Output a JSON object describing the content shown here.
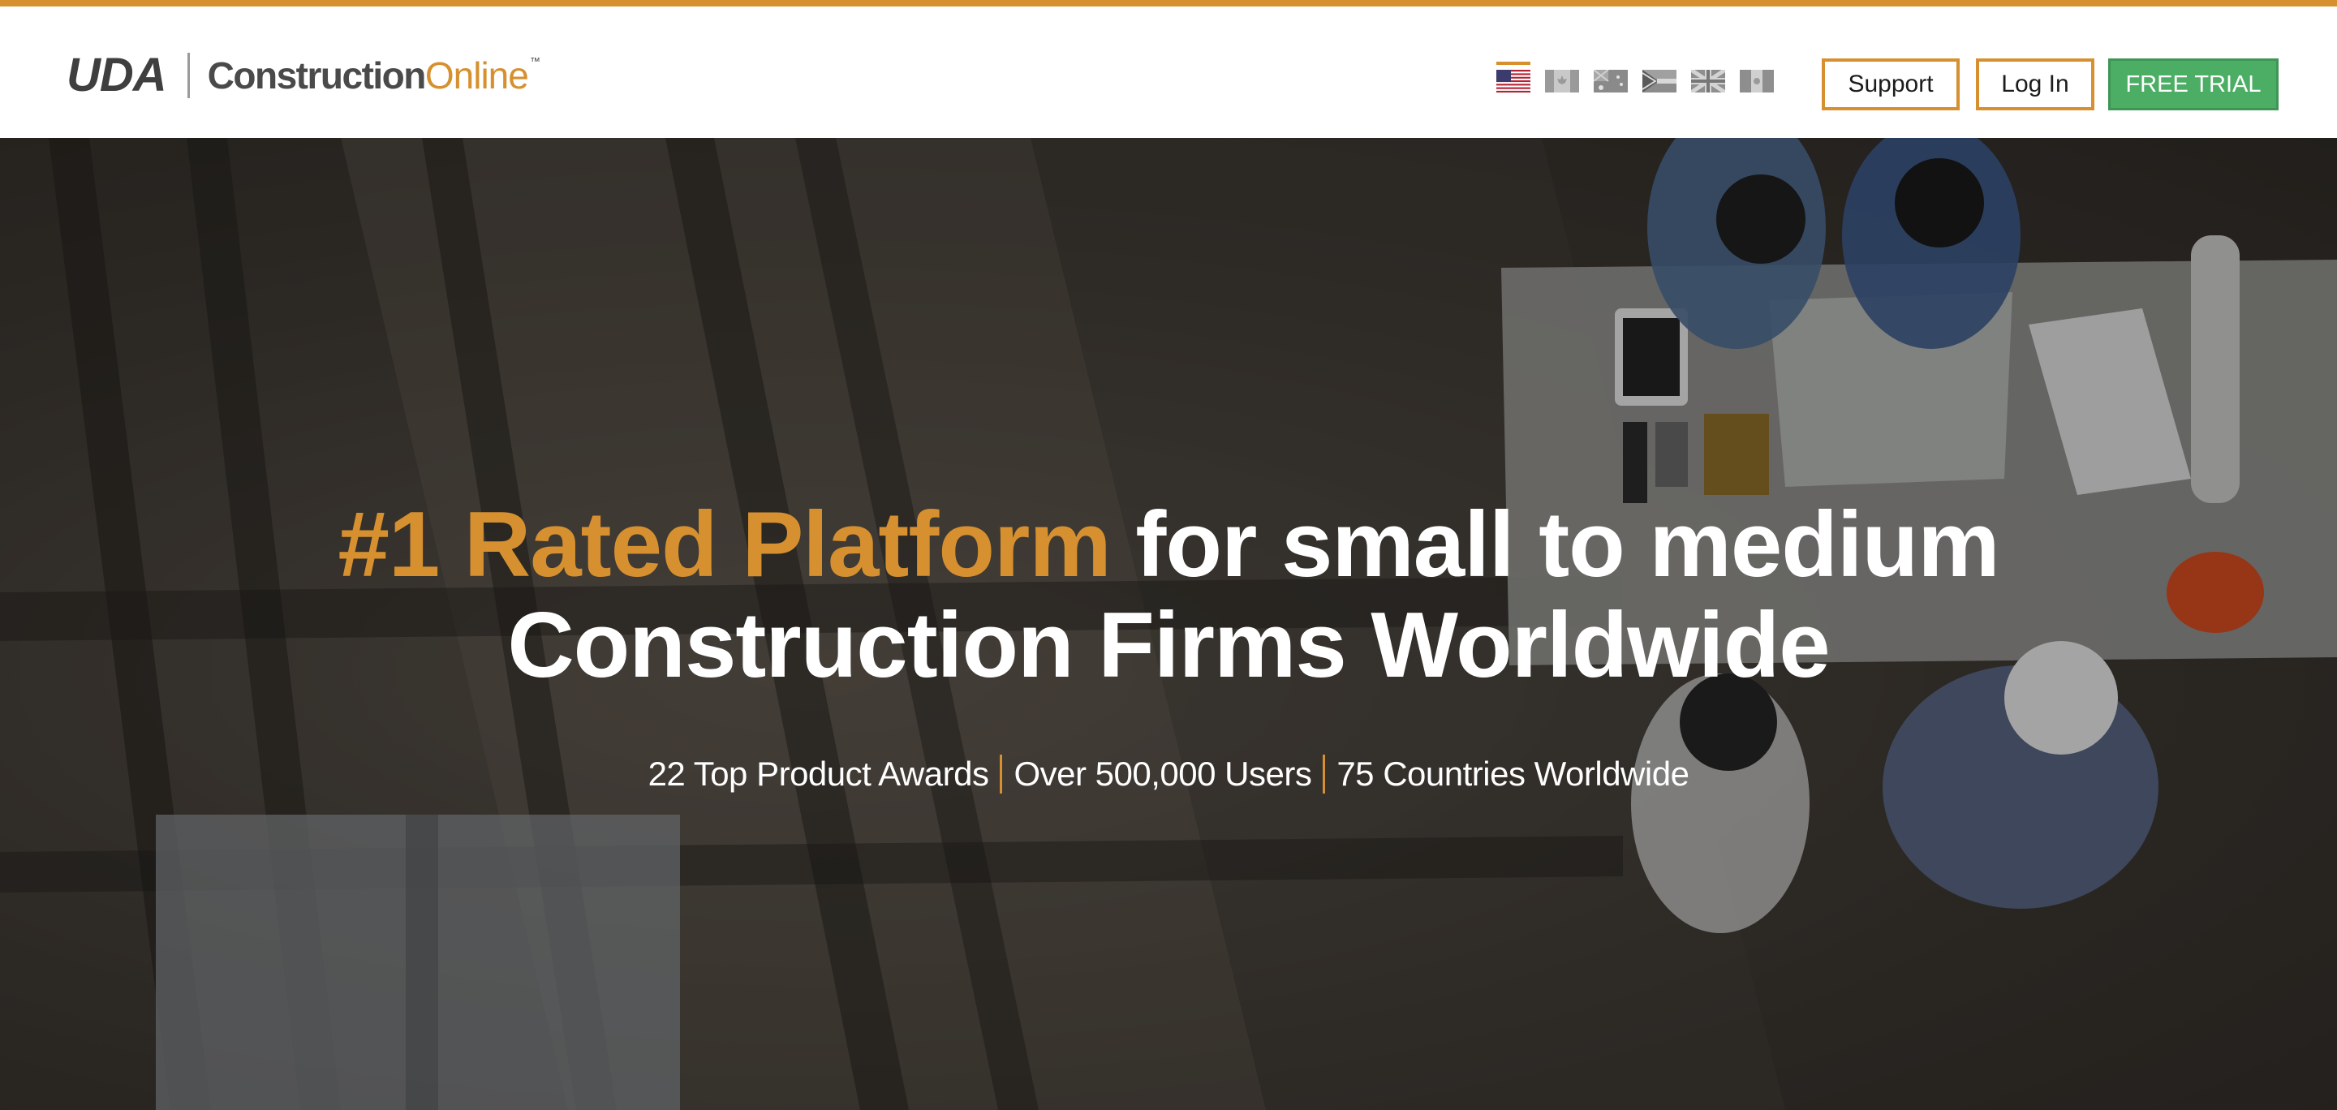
{
  "colors": {
    "accent": "#d6902f",
    "trial_green": "#4cae64",
    "header_bg": "#ffffff"
  },
  "logo": {
    "uda": "UDA",
    "construction": "Construction",
    "online": "Online",
    "tm": "™"
  },
  "flags": [
    {
      "icon": "us-flag-icon",
      "active": true
    },
    {
      "icon": "canada-flag-icon",
      "active": false
    },
    {
      "icon": "australia-flag-icon",
      "active": false
    },
    {
      "icon": "south-africa-flag-icon",
      "active": false
    },
    {
      "icon": "uk-flag-icon",
      "active": false
    },
    {
      "icon": "mexico-flag-icon",
      "active": false
    }
  ],
  "nav": {
    "support": "Support",
    "login": "Log In",
    "free_trial": "FREE TRIAL"
  },
  "hero": {
    "title_accent": "#1 Rated Platform",
    "title_rest_line1": " for small to medium",
    "title_line2": "Construction Firms Worldwide",
    "stats": [
      "22 Top Product Awards",
      "Over 500,000 Users",
      "75 Countries Worldwide"
    ]
  }
}
